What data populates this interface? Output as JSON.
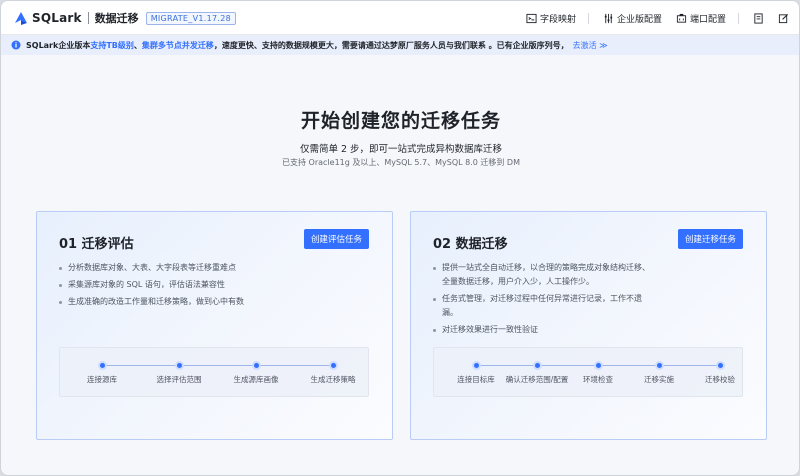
{
  "header": {
    "logo_text": "SQLark",
    "product_name": "数据迁移",
    "version": "MIGRATE_V1.17.28",
    "actions": {
      "field_mapping": "字段映射",
      "enterprise_config": "企业版配置",
      "port_config": "端口配置"
    }
  },
  "notice": {
    "prefix": "SQLark企业版本",
    "highlight1": "支持TB级别",
    "sep": "、",
    "highlight2": "集群多节点并发迁移",
    "rest": "，速度更快、支持的数据规模更大，需要请通过达梦原厂服务人员与我们联系 。已有企业版序列号，",
    "link": "去激活 ≫"
  },
  "main": {
    "title": "开始创建您的迁移任务",
    "subtitle": "仅需简单 2 步，即可一站式完成异构数据库迁移",
    "support": "已支持 Oracle11g 及以上、MySQL 5.7、MySQL 8.0 迁移到 DM"
  },
  "cards": [
    {
      "title": "01 迁移评估",
      "button": "创建评估任务",
      "features": [
        "分析数据库对象、大表、大字段表等迁移重难点",
        "采集源库对象的 SQL 语句，评估语法兼容性",
        "生成准确的改造工作量和迁移策略，做到心中有数"
      ],
      "steps": [
        "连接源库",
        "选择评估范围",
        "生成源库画像",
        "生成迁移策略"
      ]
    },
    {
      "title": "02 数据迁移",
      "button": "创建迁移任务",
      "features": [
        "提供一站式全自动迁移，以合理的策略完成对象结构迁移、",
        "全量数据迁移，用户介入少，人工操作少。",
        "任务式管理，对迁移过程中任何异常进行记录，工作不遗",
        "漏。",
        "对迁移效果进行一致性验证"
      ],
      "steps": [
        "连接目标库",
        "确认迁移范围/配置",
        "环境检查",
        "迁移实施",
        "迁移校验"
      ]
    }
  ],
  "colors": {
    "accent": "#3370ff",
    "card_border": "#b9ccf5",
    "notice_bg": "#e8eefc"
  }
}
